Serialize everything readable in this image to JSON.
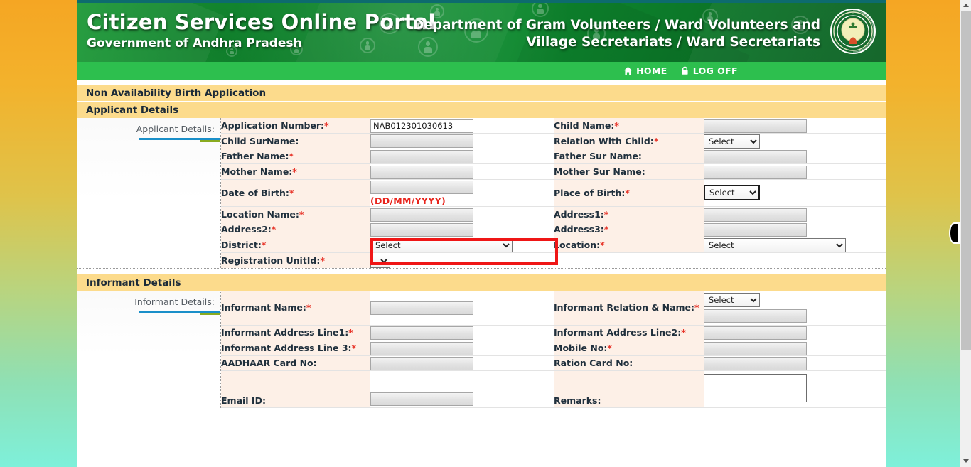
{
  "header": {
    "title_main": "Citizen Services Online Portal",
    "title_sub": "Government of Andhra Pradesh",
    "dept_line1": "Department of Gram Volunteers / Ward Volunteers and",
    "dept_line2": "Village Secretariats / Ward Secretariats",
    "emblem_name": "andhra-pradesh-government-emblem"
  },
  "nav": {
    "home_label": "HOME",
    "home_icon": "home-icon",
    "logoff_label": "LOG OFF",
    "logoff_icon": "lock-icon"
  },
  "page": {
    "form_title": "Non Availability Birth Application"
  },
  "applicant": {
    "section_title": "Applicant Details",
    "aside_label": "Applicant Details:",
    "rows": [
      {
        "left_label": "Application Number:",
        "left_required": true,
        "left_control": "text",
        "left_value": "NAB012301030613",
        "right_label": "Child Name:",
        "right_required": true,
        "right_control": "text",
        "right_value": ""
      },
      {
        "left_label": "Child SurName:",
        "left_required": false,
        "left_control": "text",
        "left_value": "",
        "right_label": "Relation With Child:",
        "right_required": true,
        "right_control": "select-small",
        "right_value": "Select"
      },
      {
        "left_label": "Father Name:",
        "left_required": true,
        "left_control": "text",
        "left_value": "",
        "right_label": "Father Sur Name:",
        "right_required": false,
        "right_control": "text",
        "right_value": ""
      },
      {
        "left_label": "Mother Name:",
        "left_required": true,
        "left_control": "text",
        "left_value": "",
        "right_label": "Mother Sur Name:",
        "right_required": false,
        "right_control": "text",
        "right_value": ""
      },
      {
        "left_label": "Date of Birth:",
        "left_required": true,
        "left_control": "text-with-hint",
        "left_value": "",
        "left_hint": "(DD/MM/YYYY)",
        "right_label": "Place of Birth:",
        "right_required": true,
        "right_control": "select-focus",
        "right_value": "Select"
      },
      {
        "left_label": "Location Name:",
        "left_required": true,
        "left_control": "text",
        "left_value": "",
        "left_highlighted": true,
        "right_label": "Address1:",
        "right_required": true,
        "right_control": "text",
        "right_value": ""
      },
      {
        "left_label": "Address2:",
        "left_required": true,
        "left_control": "text",
        "left_value": "",
        "right_label": "Address3:",
        "right_required": true,
        "right_control": "text",
        "right_value": ""
      },
      {
        "left_label": "District:",
        "left_required": true,
        "left_control": "select-wide",
        "left_value": "Select",
        "right_label": "Location:",
        "right_required": true,
        "right_control": "select-wide",
        "right_value": "Select"
      },
      {
        "left_label": "Registration UnitId:",
        "left_required": true,
        "left_control": "select-tiny",
        "left_value": "",
        "right_label": "",
        "right_required": false,
        "right_control": "none",
        "right_value": ""
      }
    ]
  },
  "informant": {
    "section_title": "Informant Details",
    "aside_label": "Informant Details:",
    "rows": [
      {
        "left_label": "Informant Name:",
        "left_required": true,
        "left_control": "text",
        "left_value": "",
        "right_label": "Informant Relation & Name:",
        "right_required": true,
        "right_control": "select-plus-text",
        "right_value": "Select",
        "right_value2": ""
      },
      {
        "left_label": "Informant Address Line1:",
        "left_required": true,
        "left_control": "text",
        "left_value": "",
        "right_label": "Informant Address Line2:",
        "right_required": true,
        "right_control": "text",
        "right_value": ""
      },
      {
        "left_label": "Informant Address Line 3:",
        "left_required": true,
        "left_control": "text",
        "left_value": "",
        "right_label": "Mobile No:",
        "right_required": true,
        "right_control": "text",
        "right_value": ""
      },
      {
        "left_label": "AADHAAR Card No:",
        "left_required": false,
        "left_control": "text",
        "left_value": "",
        "right_label": "Ration Card No:",
        "right_required": false,
        "right_control": "text",
        "right_value": ""
      },
      {
        "left_label": "Email ID:",
        "left_required": false,
        "left_control": "text",
        "left_value": "",
        "right_label": "Remarks:",
        "right_required": false,
        "right_control": "textarea",
        "right_value": ""
      }
    ]
  },
  "colors": {
    "banner_green": "#0f8f31",
    "nav_green": "#2dbf4e",
    "section_yellow": "#fcdb8c",
    "label_bg": "#fdf0e7",
    "required_red": "#e8362b",
    "highlight_red": "#ef1616",
    "aside_blue": "#1a8fc9",
    "aside_olive": "#8aab20"
  }
}
